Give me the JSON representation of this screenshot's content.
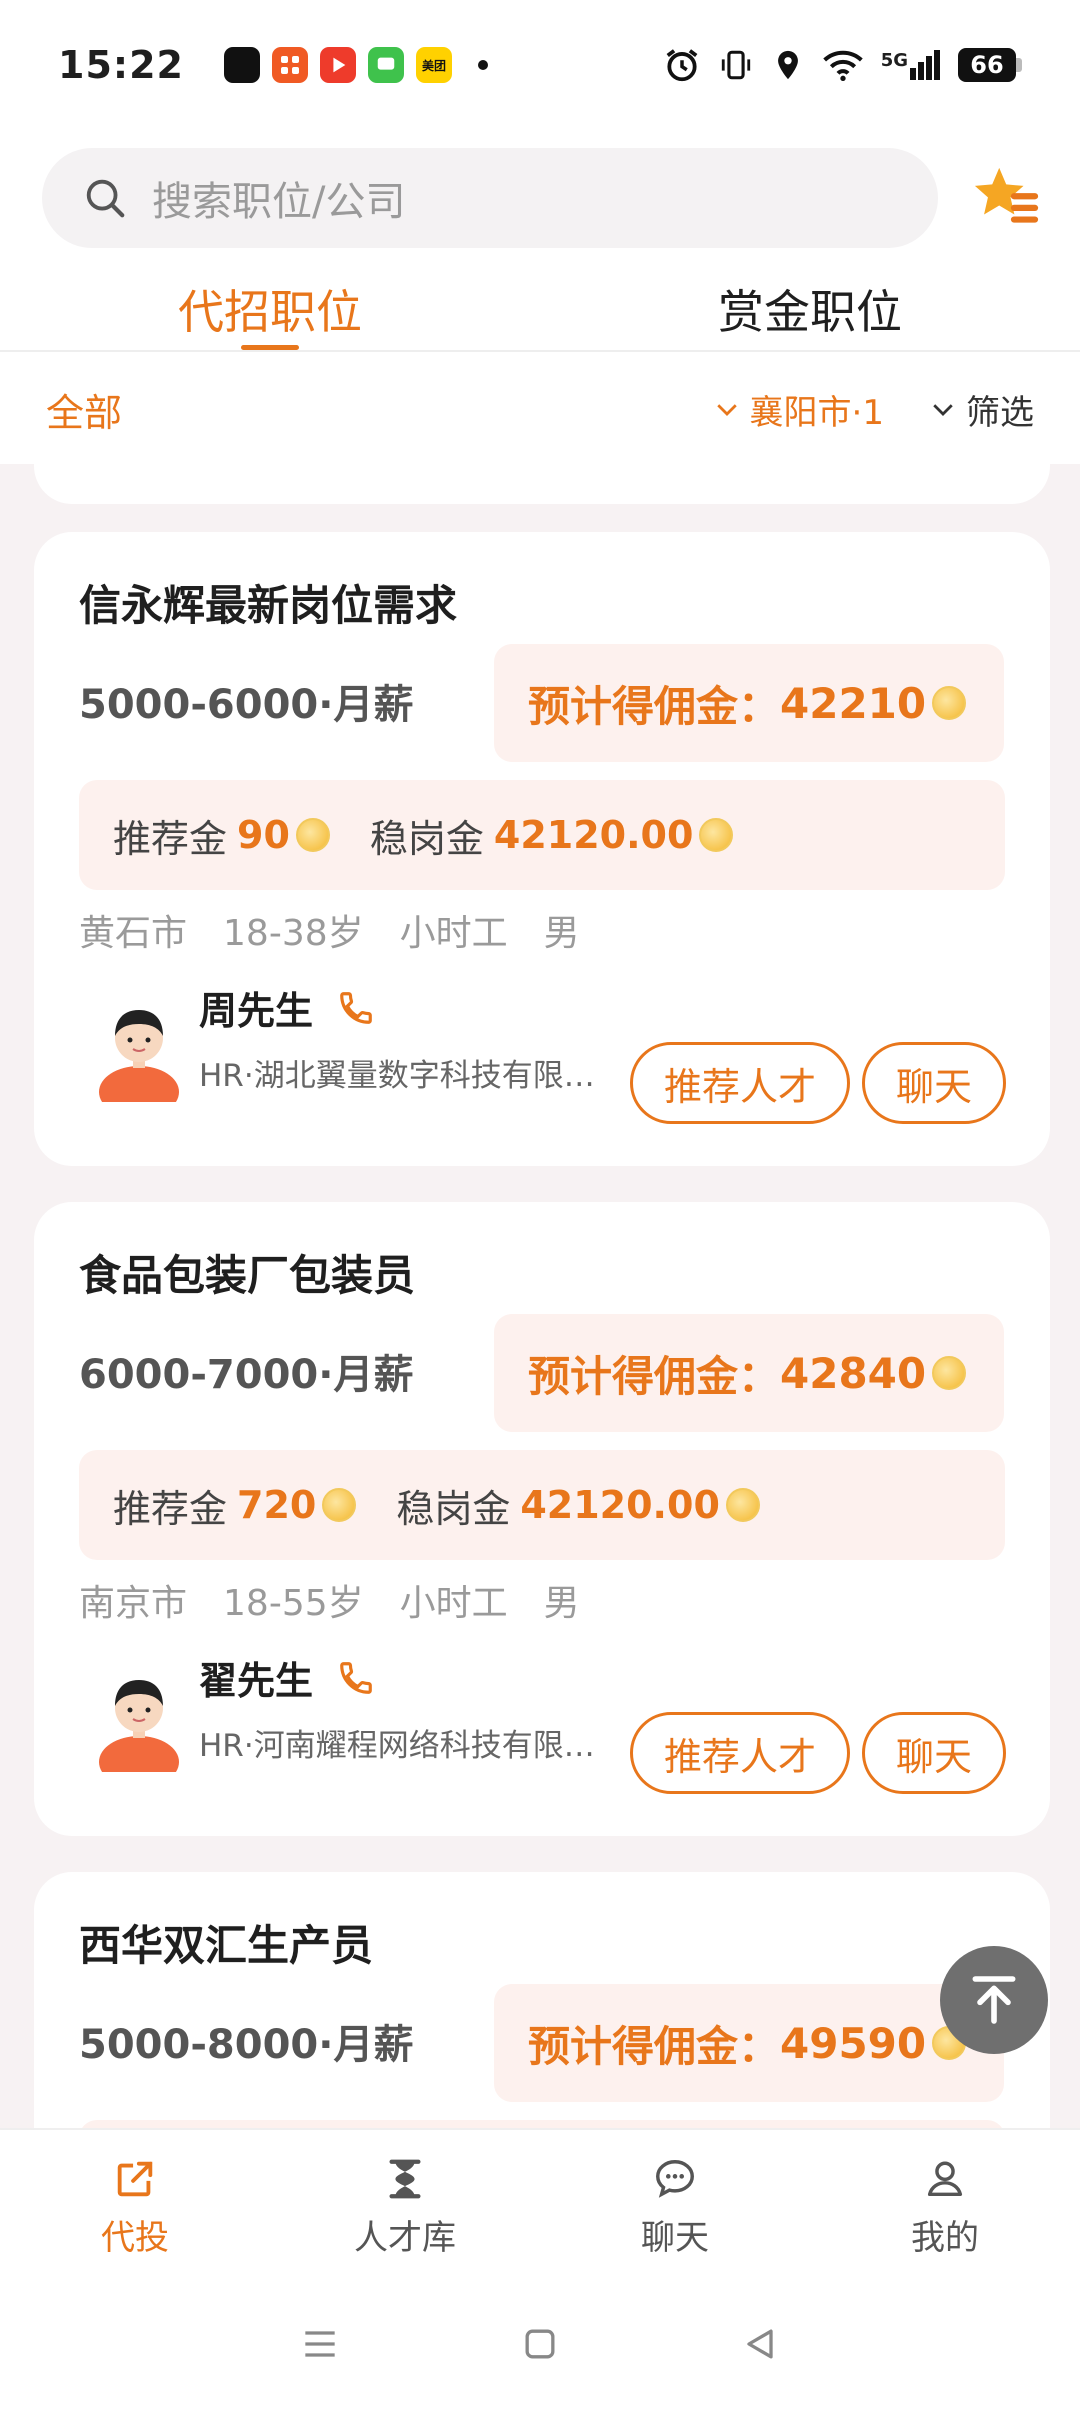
{
  "status_bar": {
    "time": "15:22",
    "meituan_label": "美团",
    "network": "5G",
    "battery": "66"
  },
  "search": {
    "placeholder": "搜索职位/公司"
  },
  "tabs": [
    {
      "label": "代招职位",
      "active": true
    },
    {
      "label": "赏金职位",
      "active": false
    }
  ],
  "filters": {
    "all_label": "全部",
    "city_label": "襄阳市·1",
    "filter_label": "筛选"
  },
  "jobs": [
    {
      "title": "信永辉最新岗位需求",
      "salary": "5000-6000·月薪",
      "commission_label": "预计得佣金：",
      "commission_value": "42210",
      "referral_label": "推荐金",
      "referral_value": "90",
      "retention_label": "稳岗金",
      "retention_value": "42120.00",
      "tags": [
        "黄石市",
        "18-38岁",
        "小时工",
        "男"
      ],
      "hr_name": "周先生",
      "hr_company": "HR·湖北翼量数字科技有限公司",
      "recommend_btn": "推荐人才",
      "chat_btn": "聊天"
    },
    {
      "title": "食品包装厂包装员",
      "salary": "6000-7000·月薪",
      "commission_label": "预计得佣金：",
      "commission_value": "42840",
      "referral_label": "推荐金",
      "referral_value": "720",
      "retention_label": "稳岗金",
      "retention_value": "42120.00",
      "tags": [
        "南京市",
        "18-55岁",
        "小时工",
        "男"
      ],
      "hr_name": "翟先生",
      "hr_company": "HR·河南耀程网络科技有限公司",
      "recommend_btn": "推荐人才",
      "chat_btn": "聊天"
    },
    {
      "title": "西华双汇生产员",
      "salary": "5000-8000·月薪",
      "commission_label": "预计得佣金：",
      "commission_value": "49590"
    }
  ],
  "bottom_nav": [
    {
      "label": "代投",
      "icon": "share-icon",
      "active": true
    },
    {
      "label": "人才库",
      "icon": "hourglass-icon",
      "active": false
    },
    {
      "label": "聊天",
      "icon": "chat-bubble-icon",
      "active": false
    },
    {
      "label": "我的",
      "icon": "user-icon",
      "active": false
    }
  ],
  "colors": {
    "accent": "#e8761b",
    "list_bg": "#f7f2f3",
    "highlight_bg": "#fdf1ee"
  }
}
